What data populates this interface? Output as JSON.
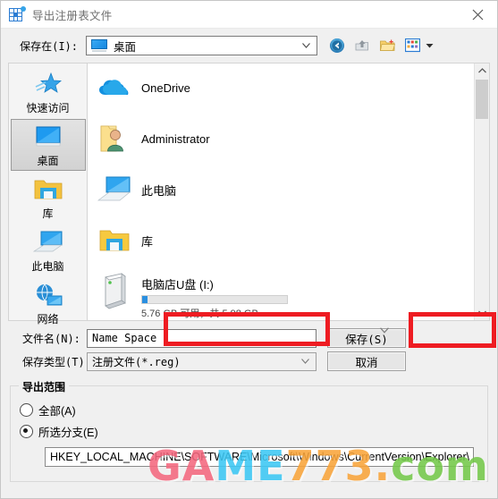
{
  "window": {
    "title": "导出注册表文件",
    "icon": "registry-icon",
    "close_label": "✕"
  },
  "toolbar": {
    "lookin_label": "保存在(I):",
    "lookin_value": "桌面",
    "icons": [
      {
        "name": "back-icon",
        "title": "后退"
      },
      {
        "name": "up-one-level-icon",
        "title": "上一级"
      },
      {
        "name": "new-folder-icon",
        "title": "新建文件夹"
      },
      {
        "name": "views-icon",
        "title": "视图"
      }
    ]
  },
  "places": [
    {
      "label": "快速访问",
      "icon": "star-icon",
      "selected": false
    },
    {
      "label": "桌面",
      "icon": "desktop-icon",
      "selected": true
    },
    {
      "label": "库",
      "icon": "library-folder-icon",
      "selected": false
    },
    {
      "label": "此电脑",
      "icon": "this-pc-icon",
      "selected": false
    },
    {
      "label": "网络",
      "icon": "network-icon",
      "selected": false
    }
  ],
  "files": [
    {
      "name": "OneDrive",
      "icon": "onedrive-cloud-icon"
    },
    {
      "name": "Administrator",
      "icon": "user-folder-icon"
    },
    {
      "name": "此电脑",
      "icon": "this-pc-icon"
    },
    {
      "name": "库",
      "icon": "library-folder-icon"
    }
  ],
  "drive": {
    "name": "电脑店U盘 (I:)",
    "icon": "removable-drive-icon",
    "capacity_text": "5.76 GB 可用，共 5.98 GB",
    "used_percent": 4
  },
  "fields": {
    "filename_label": "文件名(N):",
    "filename_value": "Name Space",
    "filetype_label": "保存类型(T):",
    "filetype_value": "注册文件(*.reg)",
    "save_button": "保存(S)",
    "cancel_button": "取消"
  },
  "export_range": {
    "title": "导出范围",
    "options": [
      {
        "label": "全部(A)",
        "checked": false
      },
      {
        "label": "所选分支(E)",
        "checked": true
      }
    ],
    "path_value": "HKEY_LOCAL_MACHINE\\SOFTWARE\\Microsoft\\Windows\\CurrentVersion\\Explorer\\"
  },
  "watermark": {
    "part1": "GA",
    "part2": "ME",
    "part3": "773.",
    "part4": "com",
    "color1": "#f4687f",
    "color2": "#3cc8f4",
    "color3": "#f9a43a",
    "color4": "#74c94a"
  },
  "annotations": {
    "accent_color": "#ee1c22"
  }
}
